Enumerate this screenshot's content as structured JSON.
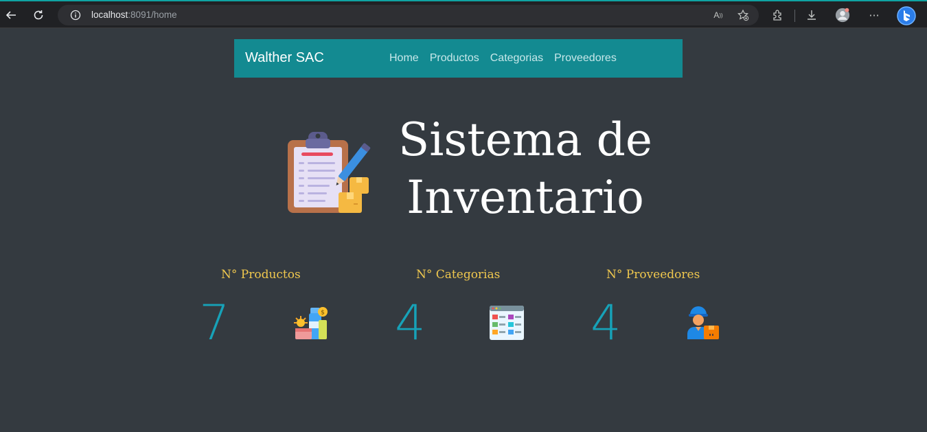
{
  "browser": {
    "url_host": "localhost",
    "url_rest": ":8091/home"
  },
  "navbar": {
    "brand": "Walther SAC",
    "links": [
      "Home",
      "Productos",
      "Categorias",
      "Proveedores"
    ]
  },
  "hero": {
    "title_line1": "Sistema de",
    "title_line2": "Inventario"
  },
  "stats": [
    {
      "label": "N° Productos",
      "value": "7",
      "icon": "products-icon"
    },
    {
      "label": "N° Categorias",
      "value": "4",
      "icon": "categories-icon"
    },
    {
      "label": "N° Proveedores",
      "value": "4",
      "icon": "supplier-icon"
    }
  ],
  "colors": {
    "background": "#343a40",
    "navbar": "#138a91",
    "stat_label": "#f0c84e",
    "stat_value": "#17a2b8"
  }
}
